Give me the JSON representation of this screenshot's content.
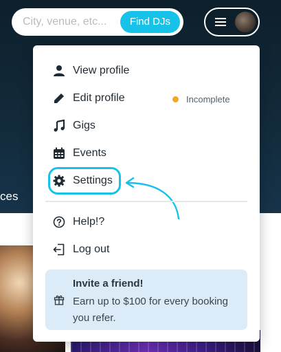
{
  "search": {
    "placeholder": "City, venue, etc...",
    "button_label": "Find DJs"
  },
  "background": {
    "partial_text": "ces"
  },
  "menu": {
    "items": [
      {
        "label": "View profile",
        "icon": "user-icon"
      },
      {
        "label": "Edit profile",
        "icon": "pencil-icon"
      },
      {
        "label": "Gigs",
        "icon": "music-note-icon"
      },
      {
        "label": "Events",
        "icon": "calendar-icon"
      },
      {
        "label": "Settings",
        "icon": "gear-icon"
      },
      {
        "label": "Help!?",
        "icon": "help-circle-icon"
      },
      {
        "label": "Log out",
        "icon": "logout-icon"
      }
    ],
    "edit_profile_status": "Incomplete",
    "invite": {
      "title": "Invite a friend!",
      "body": "Earn up to $100 for every booking you refer."
    }
  },
  "colors": {
    "accent": "#16c2e8",
    "status_warning": "#f5a623",
    "invite_bg": "#dcebf8",
    "header_bg": "#0e1f2c"
  }
}
